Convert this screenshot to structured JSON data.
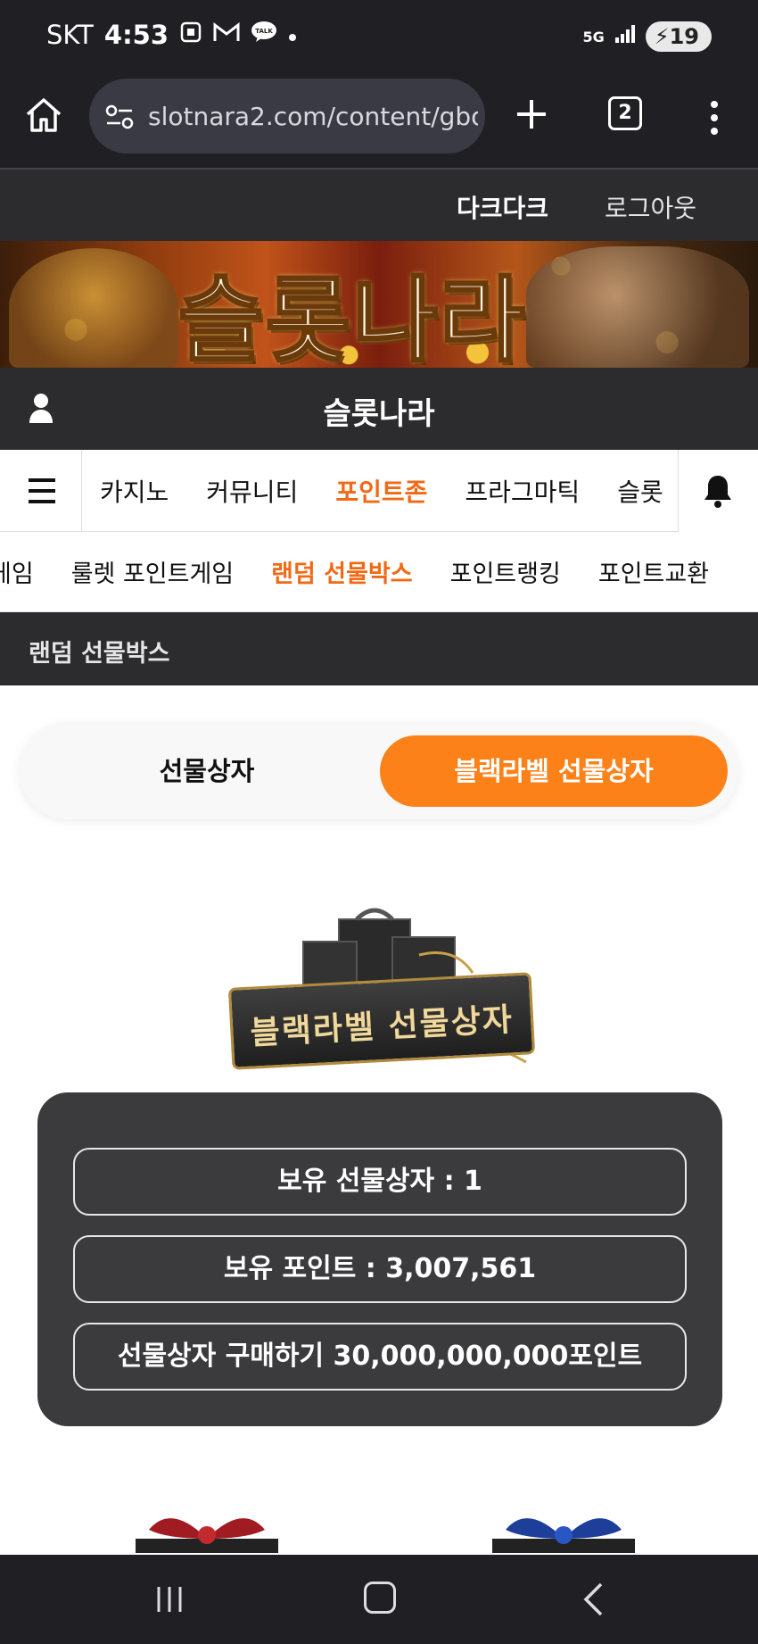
{
  "status_bar": {
    "carrier": "SKT",
    "time": "4:53",
    "network": "5G",
    "battery": "19",
    "icons": [
      "screenshot-icon",
      "gmail-icon",
      "kakaotalk-icon",
      "dot-icon",
      "signal-icon",
      "battery-icon"
    ]
  },
  "browser": {
    "url": "slotnara2.com/content/gbo",
    "tab_count": "2",
    "icons": [
      "home-icon",
      "site-settings-icon",
      "new-tab-icon",
      "tabs-icon",
      "more-icon"
    ]
  },
  "site_header": {
    "dark_mode": "다크다크",
    "logout": "로그아웃"
  },
  "banner": {
    "logo_text": "슬롯나라"
  },
  "profile_bar": {
    "title": "슬롯나라"
  },
  "main_nav": {
    "items": [
      {
        "label": "카지노",
        "active": false
      },
      {
        "label": "커뮤니티",
        "active": false
      },
      {
        "label": "포인트존",
        "active": true
      },
      {
        "label": "프라그마틱",
        "active": false
      },
      {
        "label": "슬롯",
        "active": false
      }
    ]
  },
  "sub_nav": {
    "items": [
      {
        "label": "게임",
        "active": false
      },
      {
        "label": "룰렛 포인트게임",
        "active": false
      },
      {
        "label": "랜덤 선물박스",
        "active": true
      },
      {
        "label": "포인트랭킹",
        "active": false
      },
      {
        "label": "포인트교환",
        "active": false
      }
    ]
  },
  "section": {
    "title": "랜덤 선물박스"
  },
  "toggle": {
    "option1": "선물상자",
    "option2": "블랙라벨 선물상자",
    "selected": "블랙라벨 선물상자"
  },
  "gift_box": {
    "caption": "블랙라벨 선물상자"
  },
  "info": {
    "owned_boxes": "보유 선물상자 : 1",
    "owned_points": "보유 포인트 : 3,007,561",
    "buy": "선물상자 구매하기 30,000,000,000포인트"
  },
  "colors": {
    "accent": "#fd8119",
    "active_text": "#f06a16",
    "dark_bar": "#2c2c2e",
    "panel": "#3b3a3c"
  }
}
